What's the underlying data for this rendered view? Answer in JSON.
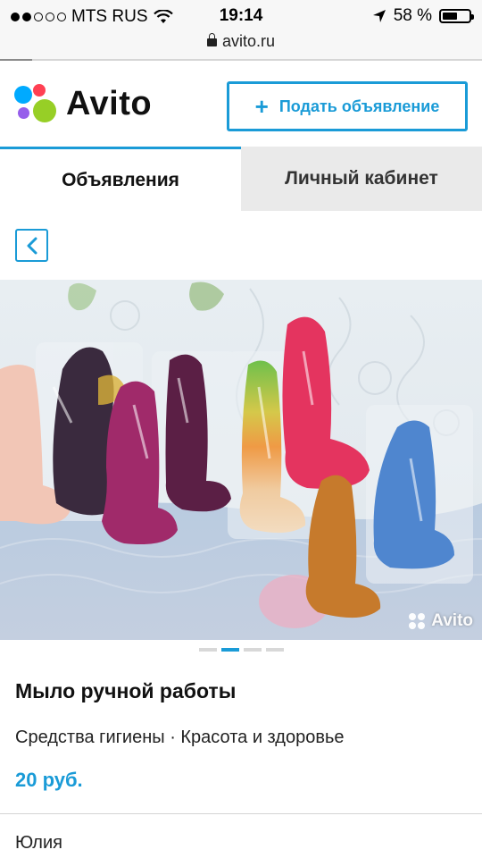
{
  "status_bar": {
    "carrier": "MTS RUS",
    "time": "19:14",
    "battery": "58 %",
    "battery_level": 0.58,
    "signal_bars": 2
  },
  "browser": {
    "url": "avito.ru"
  },
  "header": {
    "logo_text": "Avito",
    "post_button_label": "Подать объявление",
    "brand_color": "#1a9bd7"
  },
  "tabs": [
    {
      "label": "Объявления",
      "active": true
    },
    {
      "label": "Личный кабинет",
      "active": false
    }
  ],
  "listing": {
    "photo_watermark": "Avito",
    "photo_count": 4,
    "photo_index": 2,
    "title": "Мыло ручной работы",
    "category": "Средства гигиены · Красота и здоровье",
    "price": "20 руб.",
    "seller": "Юлия"
  },
  "icons": {
    "back": "chevron-left-icon",
    "lock": "lock-icon",
    "wifi": "wifi-icon",
    "location": "location-arrow-icon",
    "battery": "battery-icon",
    "plus": "plus-icon"
  }
}
